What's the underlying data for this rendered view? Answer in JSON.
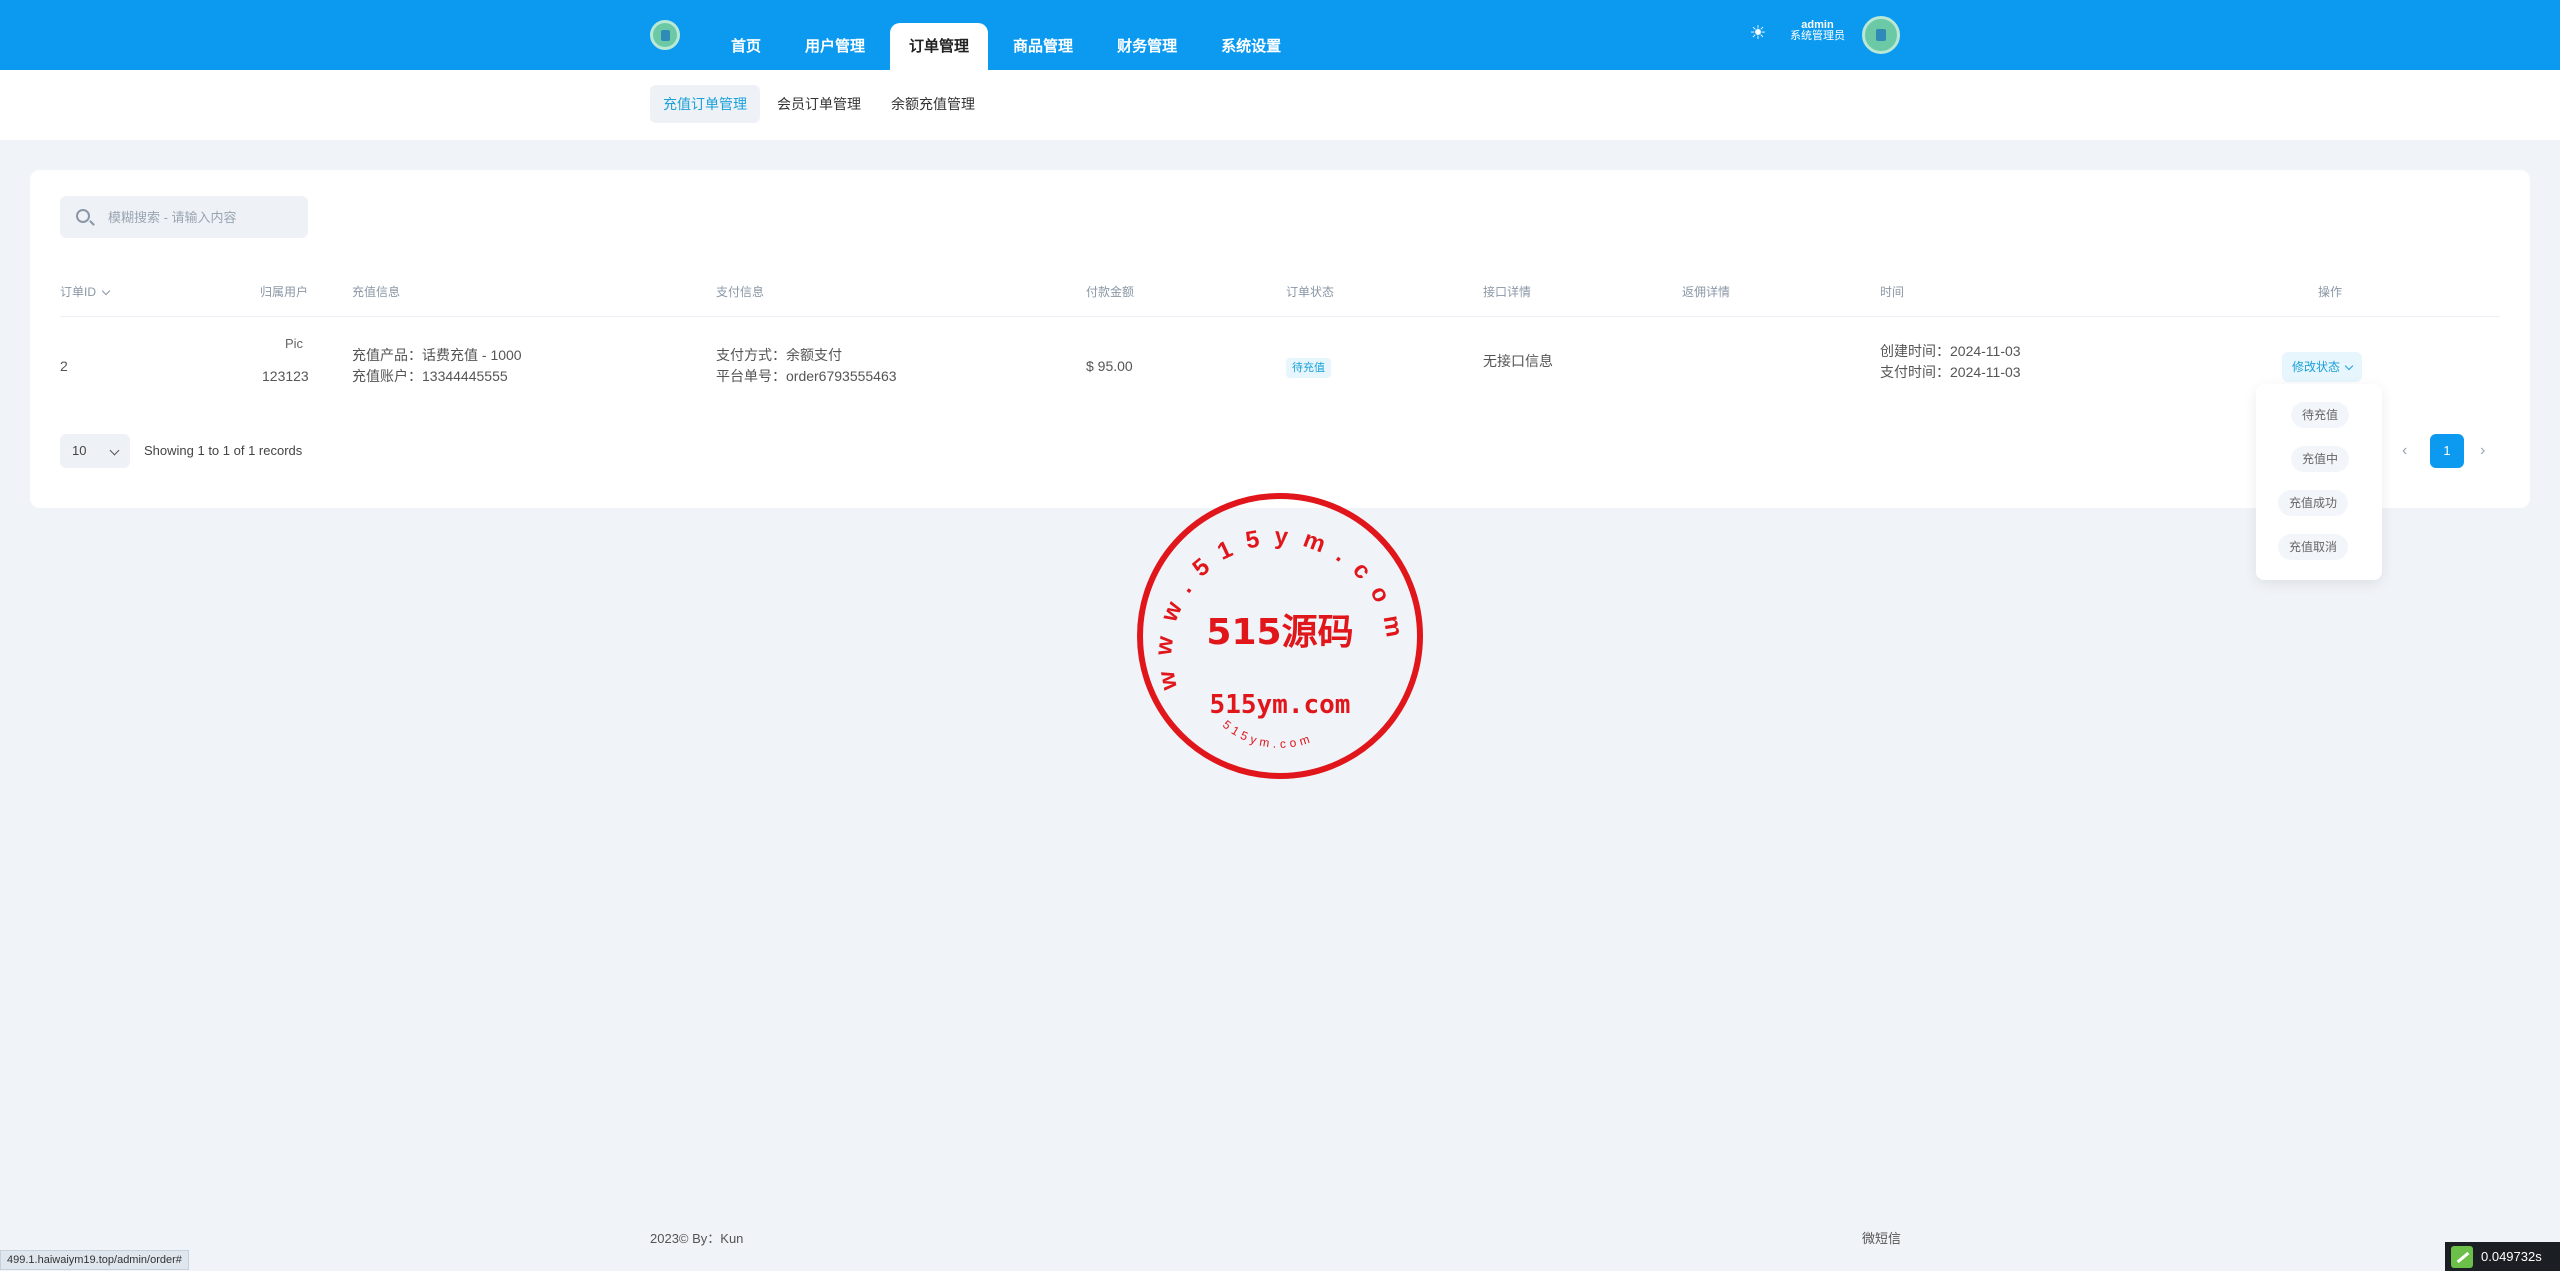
{
  "nav": {
    "items": [
      {
        "label": "首页"
      },
      {
        "label": "用户管理"
      },
      {
        "label": "订单管理"
      },
      {
        "label": "商品管理"
      },
      {
        "label": "财务管理"
      },
      {
        "label": "系统设置"
      }
    ],
    "active_index": 2
  },
  "user": {
    "name": "admin",
    "role": "系统管理员"
  },
  "subnav": {
    "items": [
      {
        "label": "充值订单管理"
      },
      {
        "label": "会员订单管理"
      },
      {
        "label": "余额充值管理"
      }
    ],
    "active_index": 0
  },
  "search": {
    "placeholder": "模糊搜索 - 请输入内容"
  },
  "table": {
    "headers": {
      "id": "订单ID",
      "user": "归属用户",
      "recharge": "充值信息",
      "payment": "支付信息",
      "amount": "付款金额",
      "status": "订单状态",
      "api": "接口详情",
      "feedback": "返佣详情",
      "time": "时间",
      "action": "操作"
    },
    "rows": [
      {
        "id": "2",
        "user_pic_alt": "Pic",
        "user": "123123",
        "recharge_product": "充值产品：话费充值 - 1000",
        "recharge_account": "充值账户：13344445555",
        "pay_method": "支付方式：余额支付",
        "pay_order": "平台单号：order6793555463",
        "amount": "$ 95.00",
        "status": "待充值",
        "api": "无接口信息",
        "created": "创建时间：2024-11-03",
        "paid": "支付时间：2024-11-03",
        "action": "修改状态"
      }
    ]
  },
  "pagination": {
    "page_size": "10",
    "summary": "Showing 1 to 1 of 1 records",
    "current_page": "1"
  },
  "dropdown": {
    "options": [
      "待充值",
      "充值中",
      "充值成功",
      "充值取消"
    ]
  },
  "stamp": {
    "ring_text": "www.515ym.com",
    "center_text": "515源码",
    "domain_text": "515ym.com",
    "bottom_text": "515ym.com",
    "color": "#e0161b"
  },
  "footer": {
    "left": "2023©  By：Kun",
    "right": "微短信"
  },
  "status_url": "499.1.haiwaiym19.top/admin/order#",
  "timer": "0.049732s",
  "colors": {
    "primary": "#0b9af0",
    "badge_text": "#1aa0d8"
  }
}
